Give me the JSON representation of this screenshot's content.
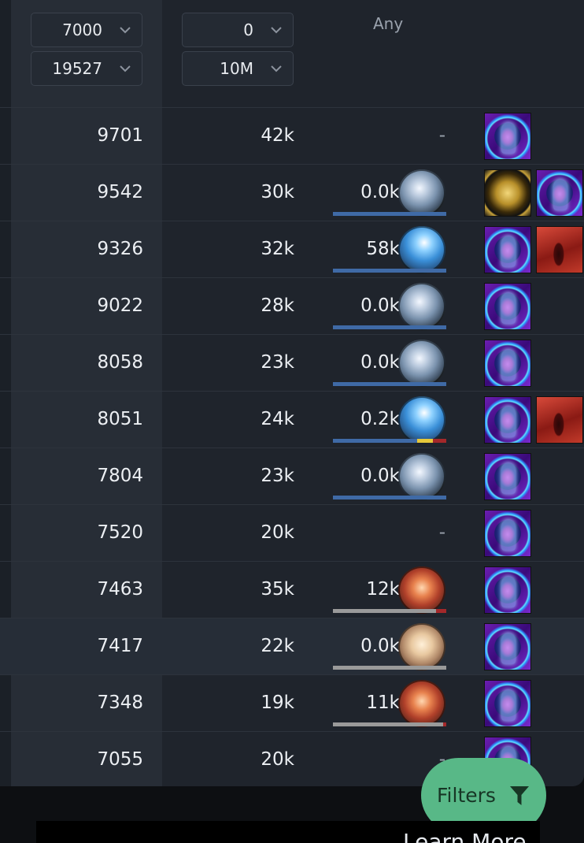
{
  "filters": {
    "col1_top": "7000",
    "col1_bottom": "19527",
    "col2_top": "0",
    "col2_bottom": "10M",
    "col3_label": "Any"
  },
  "rows": [
    {
      "c1": "9701",
      "c2": "42k",
      "c3": "-",
      "gem": null,
      "bar": null,
      "icons": [
        "aura-icon"
      ],
      "highlight": false
    },
    {
      "c1": "9542",
      "c2": "30k",
      "c3": "0.0k",
      "gem": "blue",
      "bar": [
        {
          "color": "#3f6aa6",
          "frac": 1.0
        }
      ],
      "icons": [
        "fist-icon",
        "aura-icon"
      ],
      "highlight": false
    },
    {
      "c1": "9326",
      "c2": "32k",
      "c3": "58k",
      "gem": "blue2",
      "bar": [
        {
          "color": "#3f6aa6",
          "frac": 1.0
        }
      ],
      "icons": [
        "aura-icon",
        "red-skill-icon"
      ],
      "highlight": false
    },
    {
      "c1": "9022",
      "c2": "28k",
      "c3": "0.0k",
      "gem": "blue",
      "bar": [
        {
          "color": "#3f6aa6",
          "frac": 1.0
        }
      ],
      "icons": [
        "aura-icon"
      ],
      "highlight": false
    },
    {
      "c1": "8058",
      "c2": "23k",
      "c3": "0.0k",
      "gem": "blue",
      "bar": [
        {
          "color": "#3f6aa6",
          "frac": 1.0
        }
      ],
      "icons": [
        "aura-icon"
      ],
      "highlight": false
    },
    {
      "c1": "8051",
      "c2": "24k",
      "c3": "0.2k",
      "gem": "blue2",
      "bar": [
        {
          "color": "#3f6aa6",
          "frac": 0.74
        },
        {
          "color": "#e7c83a",
          "frac": 0.14
        },
        {
          "color": "#a4282a",
          "frac": 0.12
        }
      ],
      "icons": [
        "aura-icon",
        "red-skill-icon"
      ],
      "highlight": false
    },
    {
      "c1": "7804",
      "c2": "23k",
      "c3": "0.0k",
      "gem": "blue",
      "bar": [
        {
          "color": "#3f6aa6",
          "frac": 1.0
        }
      ],
      "icons": [
        "aura-icon"
      ],
      "highlight": false
    },
    {
      "c1": "7520",
      "c2": "20k",
      "c3": "-",
      "gem": null,
      "bar": null,
      "icons": [
        "aura-icon"
      ],
      "highlight": false
    },
    {
      "c1": "7463",
      "c2": "35k",
      "c3": "12k",
      "gem": "fire",
      "bar": [
        {
          "color": "#9a9a9a",
          "frac": 0.91
        },
        {
          "color": "#a4282a",
          "frac": 0.09
        }
      ],
      "icons": [
        "aura-icon"
      ],
      "highlight": false
    },
    {
      "c1": "7417",
      "c2": "22k",
      "c3": "0.0k",
      "gem": "tan",
      "bar": [
        {
          "color": "#9a9a9a",
          "frac": 1.0
        }
      ],
      "icons": [
        "aura-icon"
      ],
      "highlight": true
    },
    {
      "c1": "7348",
      "c2": "19k",
      "c3": "11k",
      "gem": "fire",
      "bar": [
        {
          "color": "#9a9a9a",
          "frac": 0.97
        },
        {
          "color": "#a4282a",
          "frac": 0.03
        }
      ],
      "icons": [
        "aura-icon"
      ],
      "highlight": false
    },
    {
      "c1": "7055",
      "c2": "20k",
      "c3": "-",
      "gem": null,
      "bar": null,
      "icons": [
        "aura-icon"
      ],
      "highlight": false
    }
  ],
  "filters_button": {
    "label": "Filters",
    "icon": "funnel-icon"
  },
  "footer": {
    "learn_more": "Learn More"
  }
}
